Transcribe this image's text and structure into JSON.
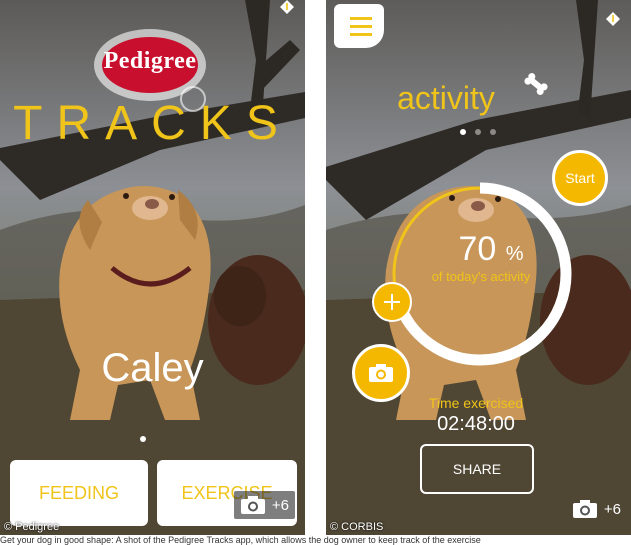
{
  "left": {
    "brand": "Pedigree",
    "app_title": "TRACKS",
    "dog_name": "Caley",
    "buttons": {
      "feeding": "FEEDING",
      "exercise": "EXERCISE"
    },
    "photo_count": "+6",
    "credit": "© Pedigree"
  },
  "right": {
    "section_title": "activity",
    "start_label": "Start",
    "progress_percent": 70,
    "progress_percent_text": "70",
    "percent_sign": "%",
    "progress_caption": "of today's activity",
    "time_label": "Time exercised",
    "time_value": "02:48:00",
    "share_label": "SHARE",
    "photo_count": "+6",
    "credit": "© CORBIS",
    "carousel_pages": 3,
    "carousel_active": 0
  },
  "caption": "Get your dog in good shape: A shot of the Pedigree Tracks app, which allows the dog owner to keep track of the exercise",
  "colors": {
    "accent": "#f0c419",
    "button_fill": "#f5b800",
    "brand_red": "#c8102e"
  },
  "icons": [
    "menu-icon",
    "bone-icon",
    "camera-icon",
    "plus-icon",
    "info-icon"
  ]
}
